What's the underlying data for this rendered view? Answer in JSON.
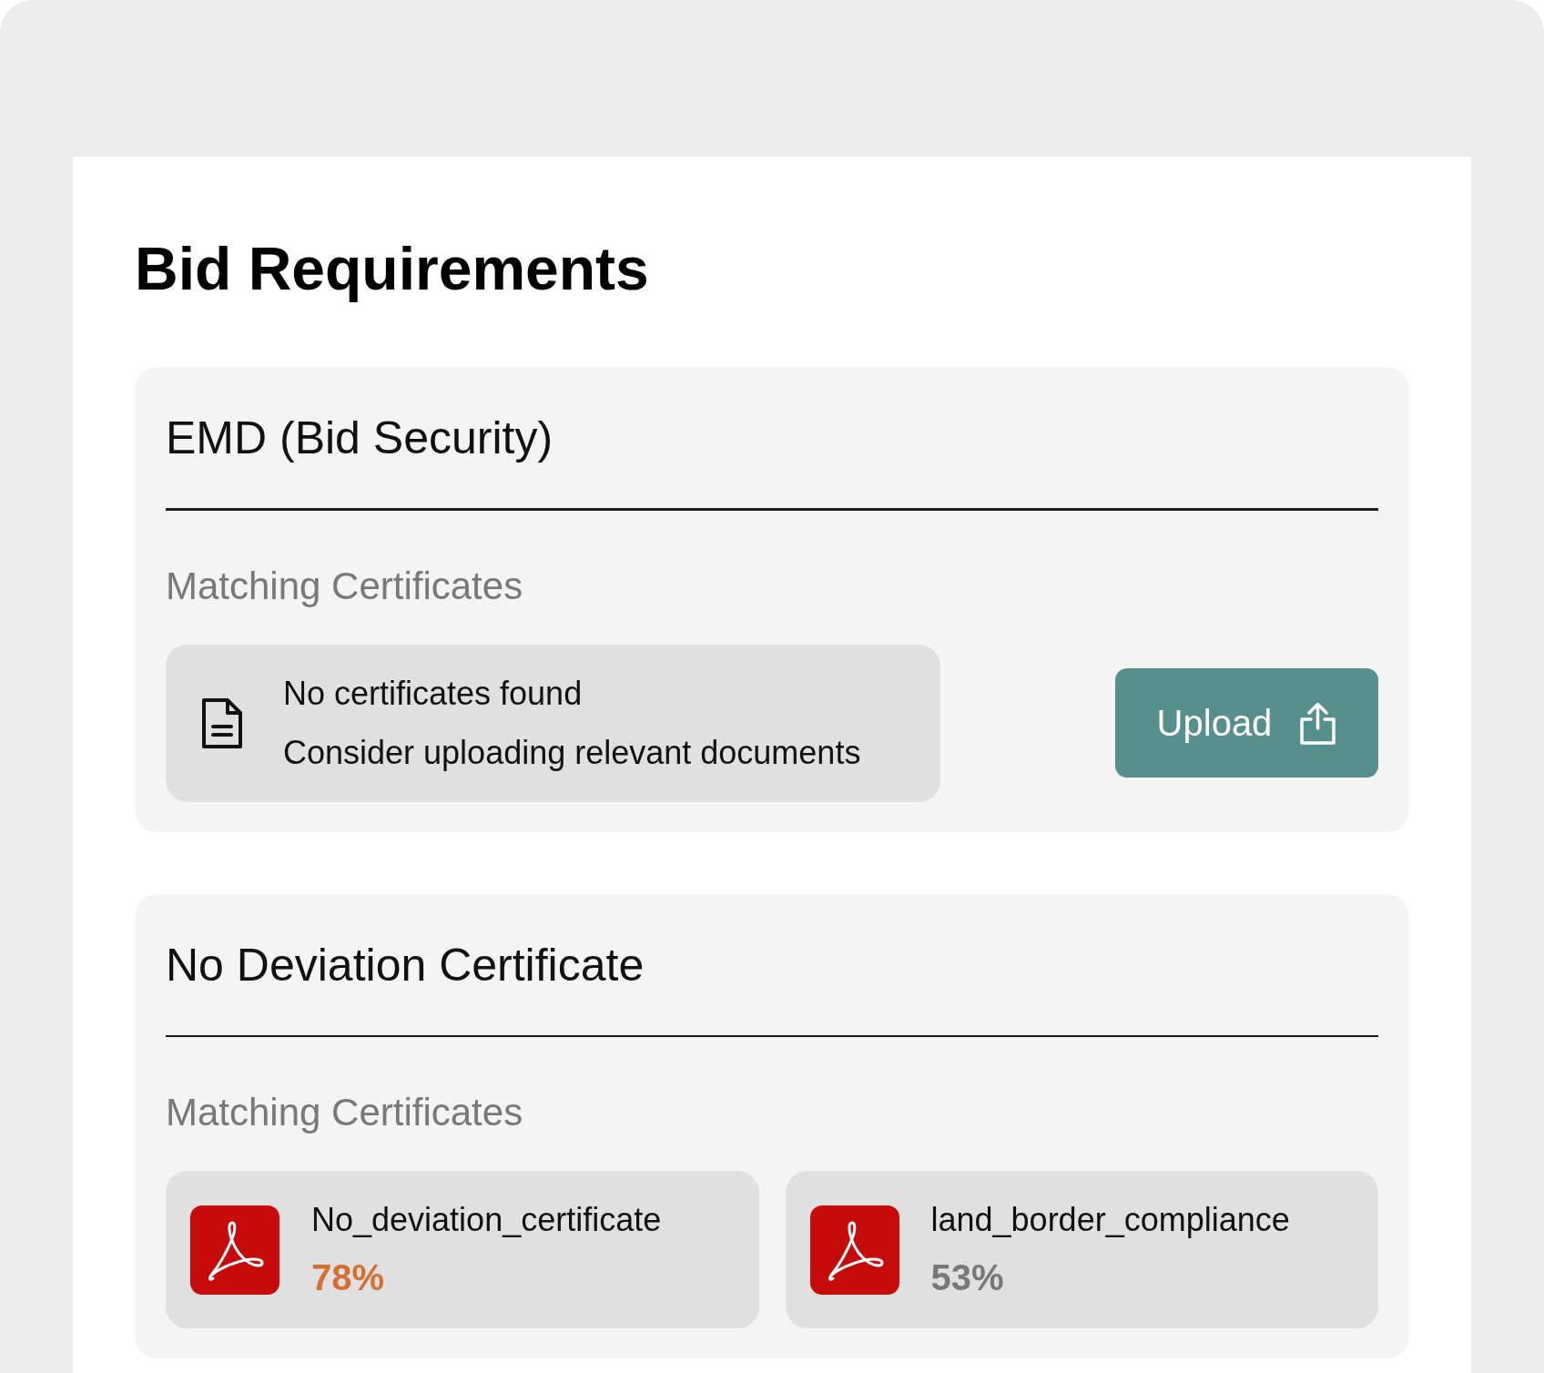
{
  "page": {
    "title": "Bid Requirements"
  },
  "requirements": [
    {
      "kind": "empty",
      "title": "EMD (Bid Security)",
      "section_label": "Matching Certificates",
      "empty_state": {
        "heading": "No certificates found",
        "message": "Consider uploading relevant documents"
      },
      "action": {
        "label": "Upload"
      }
    },
    {
      "kind": "matches",
      "title": "No Deviation Certificate",
      "section_label": "Matching Certificates",
      "certificates": [
        {
          "name": "No_deviation_certificate",
          "match": "78%",
          "color": "#d67030"
        },
        {
          "name": "land_border_compliance",
          "match": "53%",
          "color": "#787878"
        }
      ]
    }
  ]
}
